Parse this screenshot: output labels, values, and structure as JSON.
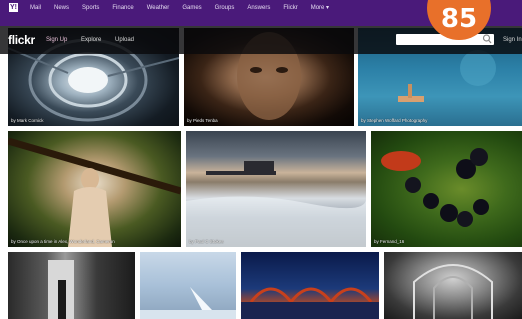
{
  "yahoo_bar": {
    "logo": "Y!",
    "links": [
      "Mail",
      "News",
      "Sports",
      "Finance",
      "Weather",
      "Games",
      "Groups",
      "Answers",
      "Flickr",
      "More ▾"
    ]
  },
  "flickr_bar": {
    "logo": "flickr",
    "signup": "Sign Up",
    "explore": "Explore",
    "upload": "Upload",
    "search_value": "",
    "signin": "Sign In"
  },
  "badge": {
    "number": "85"
  },
  "photos": [
    {
      "caption": "by Mark Cornick"
    },
    {
      "caption": "by Pieds Tenba"
    },
    {
      "caption": "by Stephen Woffard Photography"
    },
    {
      "caption": "by Once upon a time in Alex, Wonderland, Cameron"
    },
    {
      "caption": "by Paul C Stokes"
    },
    {
      "caption": "by Fernand_16"
    },
    {
      "caption": ""
    },
    {
      "caption": ""
    },
    {
      "caption": ""
    },
    {
      "caption": ""
    }
  ],
  "colors": {
    "yahoo_purple": "#4a1a7a",
    "badge_orange": "#e8702a",
    "flickr_pink": "#e8c0d8"
  }
}
